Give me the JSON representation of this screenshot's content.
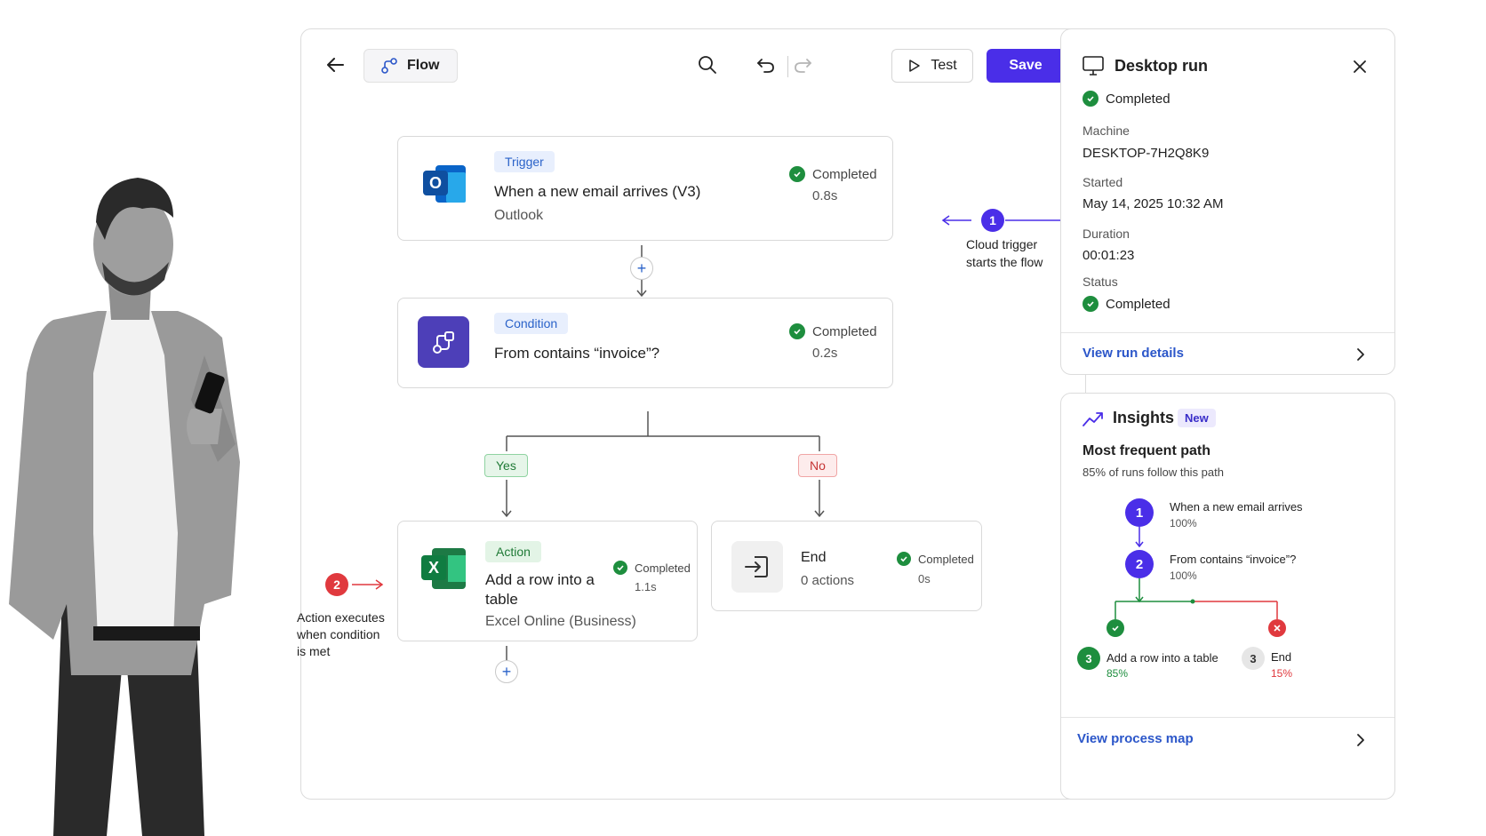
{
  "toolbar": {
    "flow_label": "Flow",
    "test_label": "Test",
    "save_label": "Save"
  },
  "trigger_node": {
    "tag": "Trigger",
    "title": "When a new email arrives (V3)",
    "subtitle": "Outlook",
    "status": "Completed",
    "duration": "0.8s",
    "icon": "outlook-icon"
  },
  "condition_node": {
    "tag": "Condition",
    "title": "From contains “invoice”?",
    "status": "Completed",
    "duration": "0.2s",
    "icon": "condition-icon"
  },
  "branches": {
    "yes": "Yes",
    "no": "No"
  },
  "action_node": {
    "tag": "Action",
    "title_line1": "Add a row into a",
    "title_line2": "table",
    "subtitle": "Excel Online (Business)",
    "status": "Completed",
    "duration": "1.1s",
    "icon": "excel-icon"
  },
  "end_node": {
    "title": "End",
    "subtitle": "0 actions",
    "status": "Completed",
    "duration": "0s",
    "icon": "exit-icon"
  },
  "callouts": {
    "one": {
      "num": "1",
      "line1": "Cloud trigger",
      "line2": "starts the flow"
    },
    "two": {
      "num": "2",
      "line1": "Action executes",
      "line2": "when condition",
      "line3": "is met"
    }
  },
  "desktop_run": {
    "title": "Desktop run",
    "status_top": "Completed",
    "machine_label": "Machine",
    "machine_value": "DESKTOP-7H2Q8K9",
    "started_label": "Started",
    "started_value": "May 14, 2025 10:32 AM",
    "duration_label": "Duration",
    "duration_value": "00:01:23",
    "status_label": "Status",
    "status_value": "Completed",
    "link": "View run details"
  },
  "insights": {
    "title": "Insights",
    "badge": "New",
    "heading": "Most frequent path",
    "subheading": "85% of runs follow this path",
    "steps": [
      {
        "num": "1",
        "title": "When a new email arrives",
        "pct": "100%"
      },
      {
        "num": "2",
        "title": "From contains “invoice”?",
        "pct": "100%"
      },
      {
        "num": "3",
        "title": "Add a row into a table",
        "pct": "85%"
      },
      {
        "num": "3",
        "title": "End",
        "pct": "15%"
      }
    ],
    "link": "View process map"
  },
  "colors": {
    "accent": "#4a2ee8",
    "success": "#1e8e3e",
    "danger": "#e0393e",
    "link": "#2b56c9"
  }
}
